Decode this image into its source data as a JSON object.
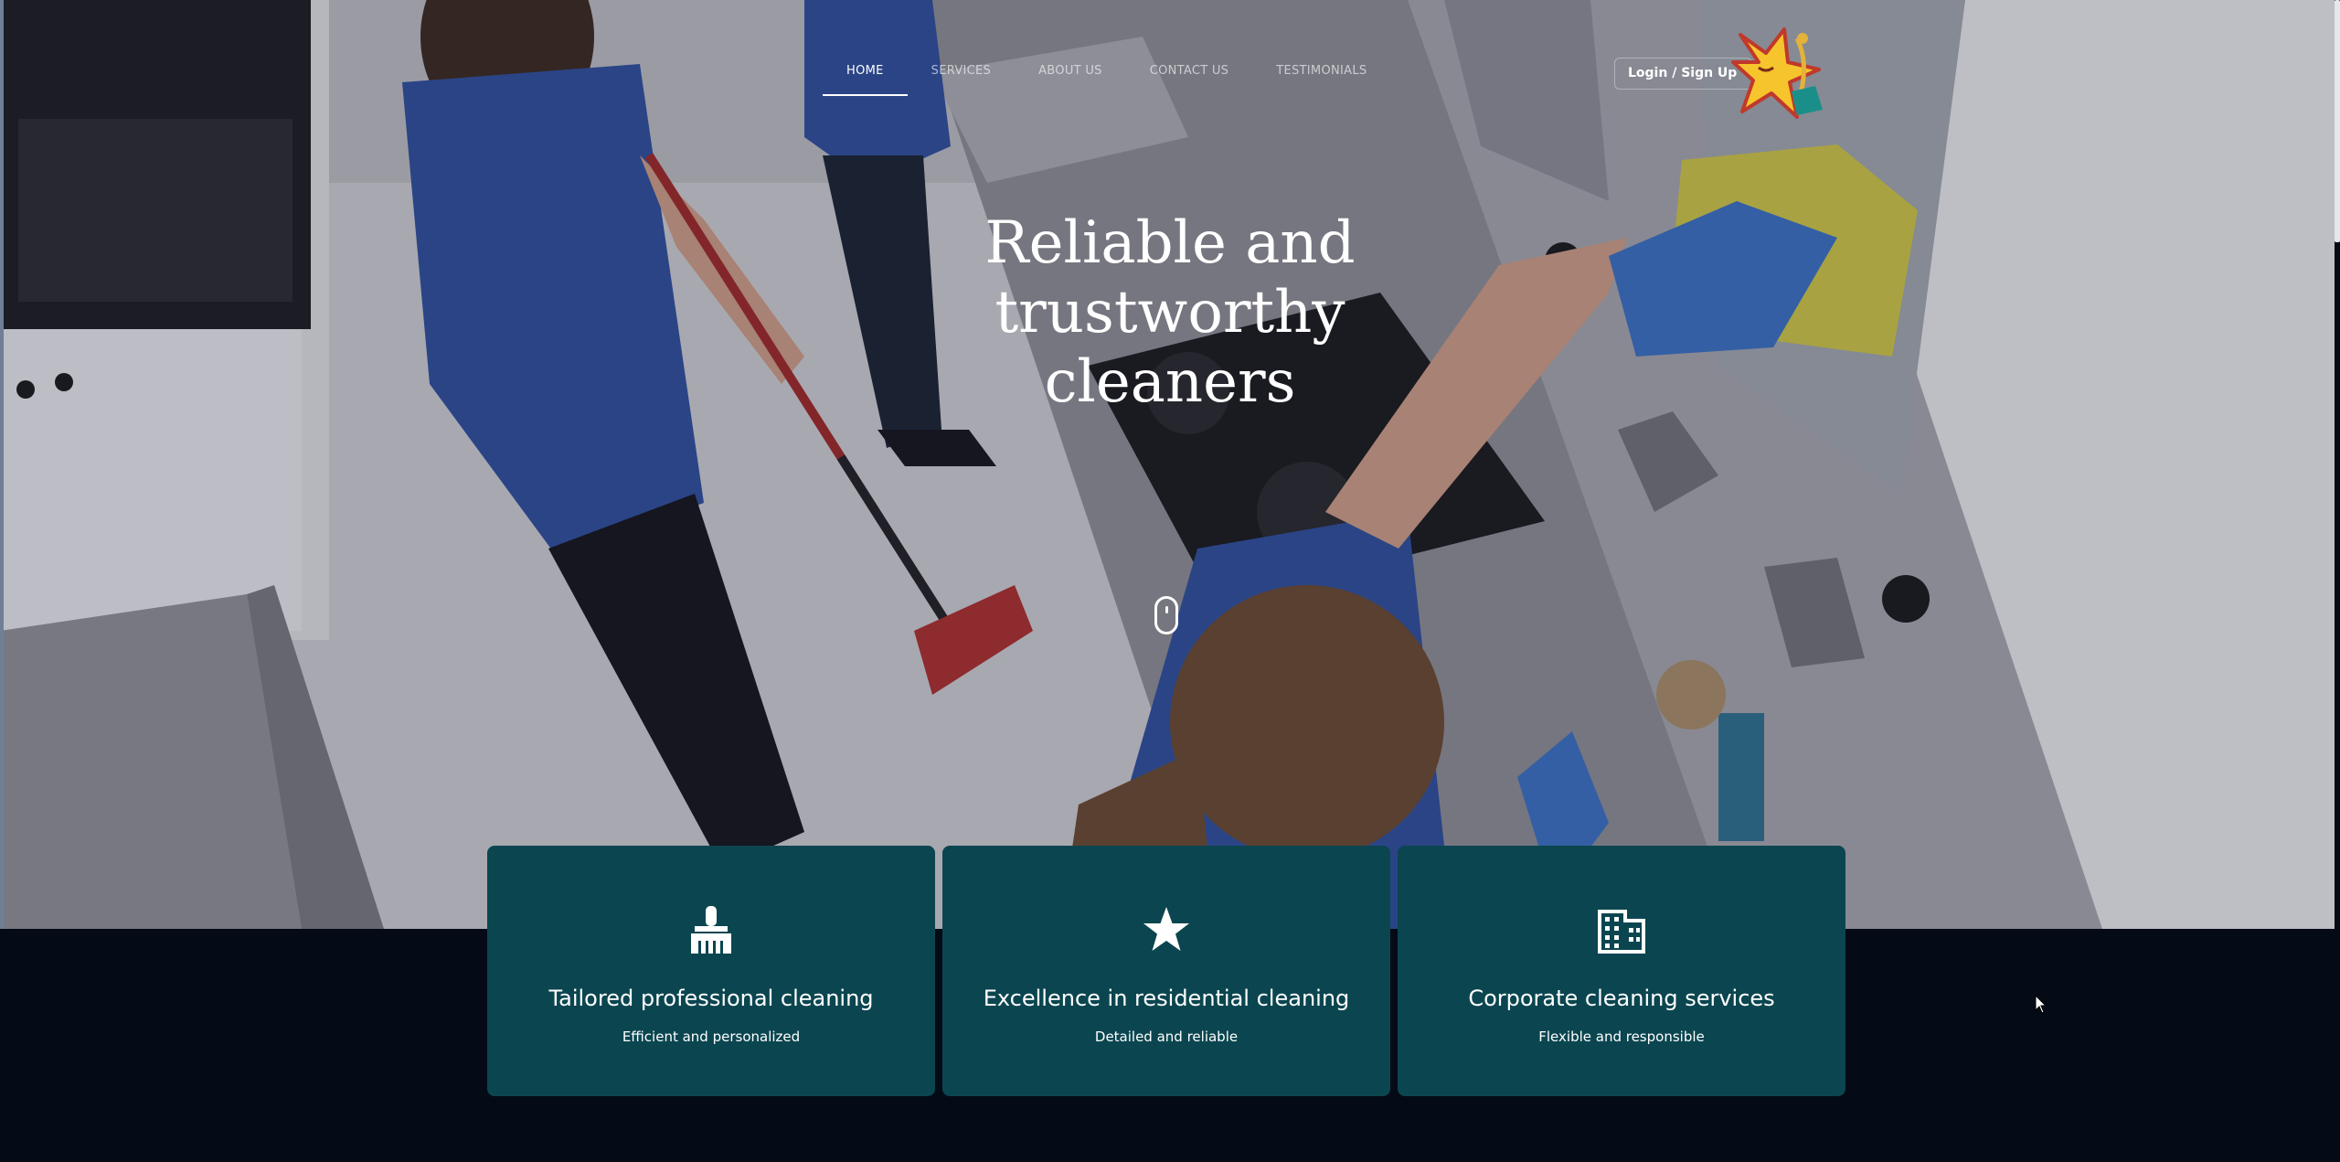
{
  "nav": {
    "items": [
      {
        "label": "HOME",
        "active": true
      },
      {
        "label": "SERVICES",
        "active": false
      },
      {
        "label": "ABOUT US",
        "active": false
      },
      {
        "label": "CONTACT US",
        "active": false
      },
      {
        "label": "TESTIMONIALS",
        "active": false
      }
    ],
    "login_label": "Login / Sign Up"
  },
  "hero": {
    "headline_line1": "Reliable and trustworthy",
    "headline_line2": "cleaners",
    "scroll_icon": "mouse-scroll-icon"
  },
  "features": [
    {
      "icon": "broom-icon",
      "title": "Tailored professional cleaning",
      "subtitle": "Efficient and personalized"
    },
    {
      "icon": "star-icon",
      "title": "Excellence in residential cleaning",
      "subtitle": "Detailed and reliable"
    },
    {
      "icon": "building-icon",
      "title": "Corporate cleaning services",
      "subtitle": "Flexible and responsible"
    }
  ],
  "colors": {
    "card_background": "#0b4650",
    "page_background": "#040b17",
    "text": "#ffffff"
  }
}
